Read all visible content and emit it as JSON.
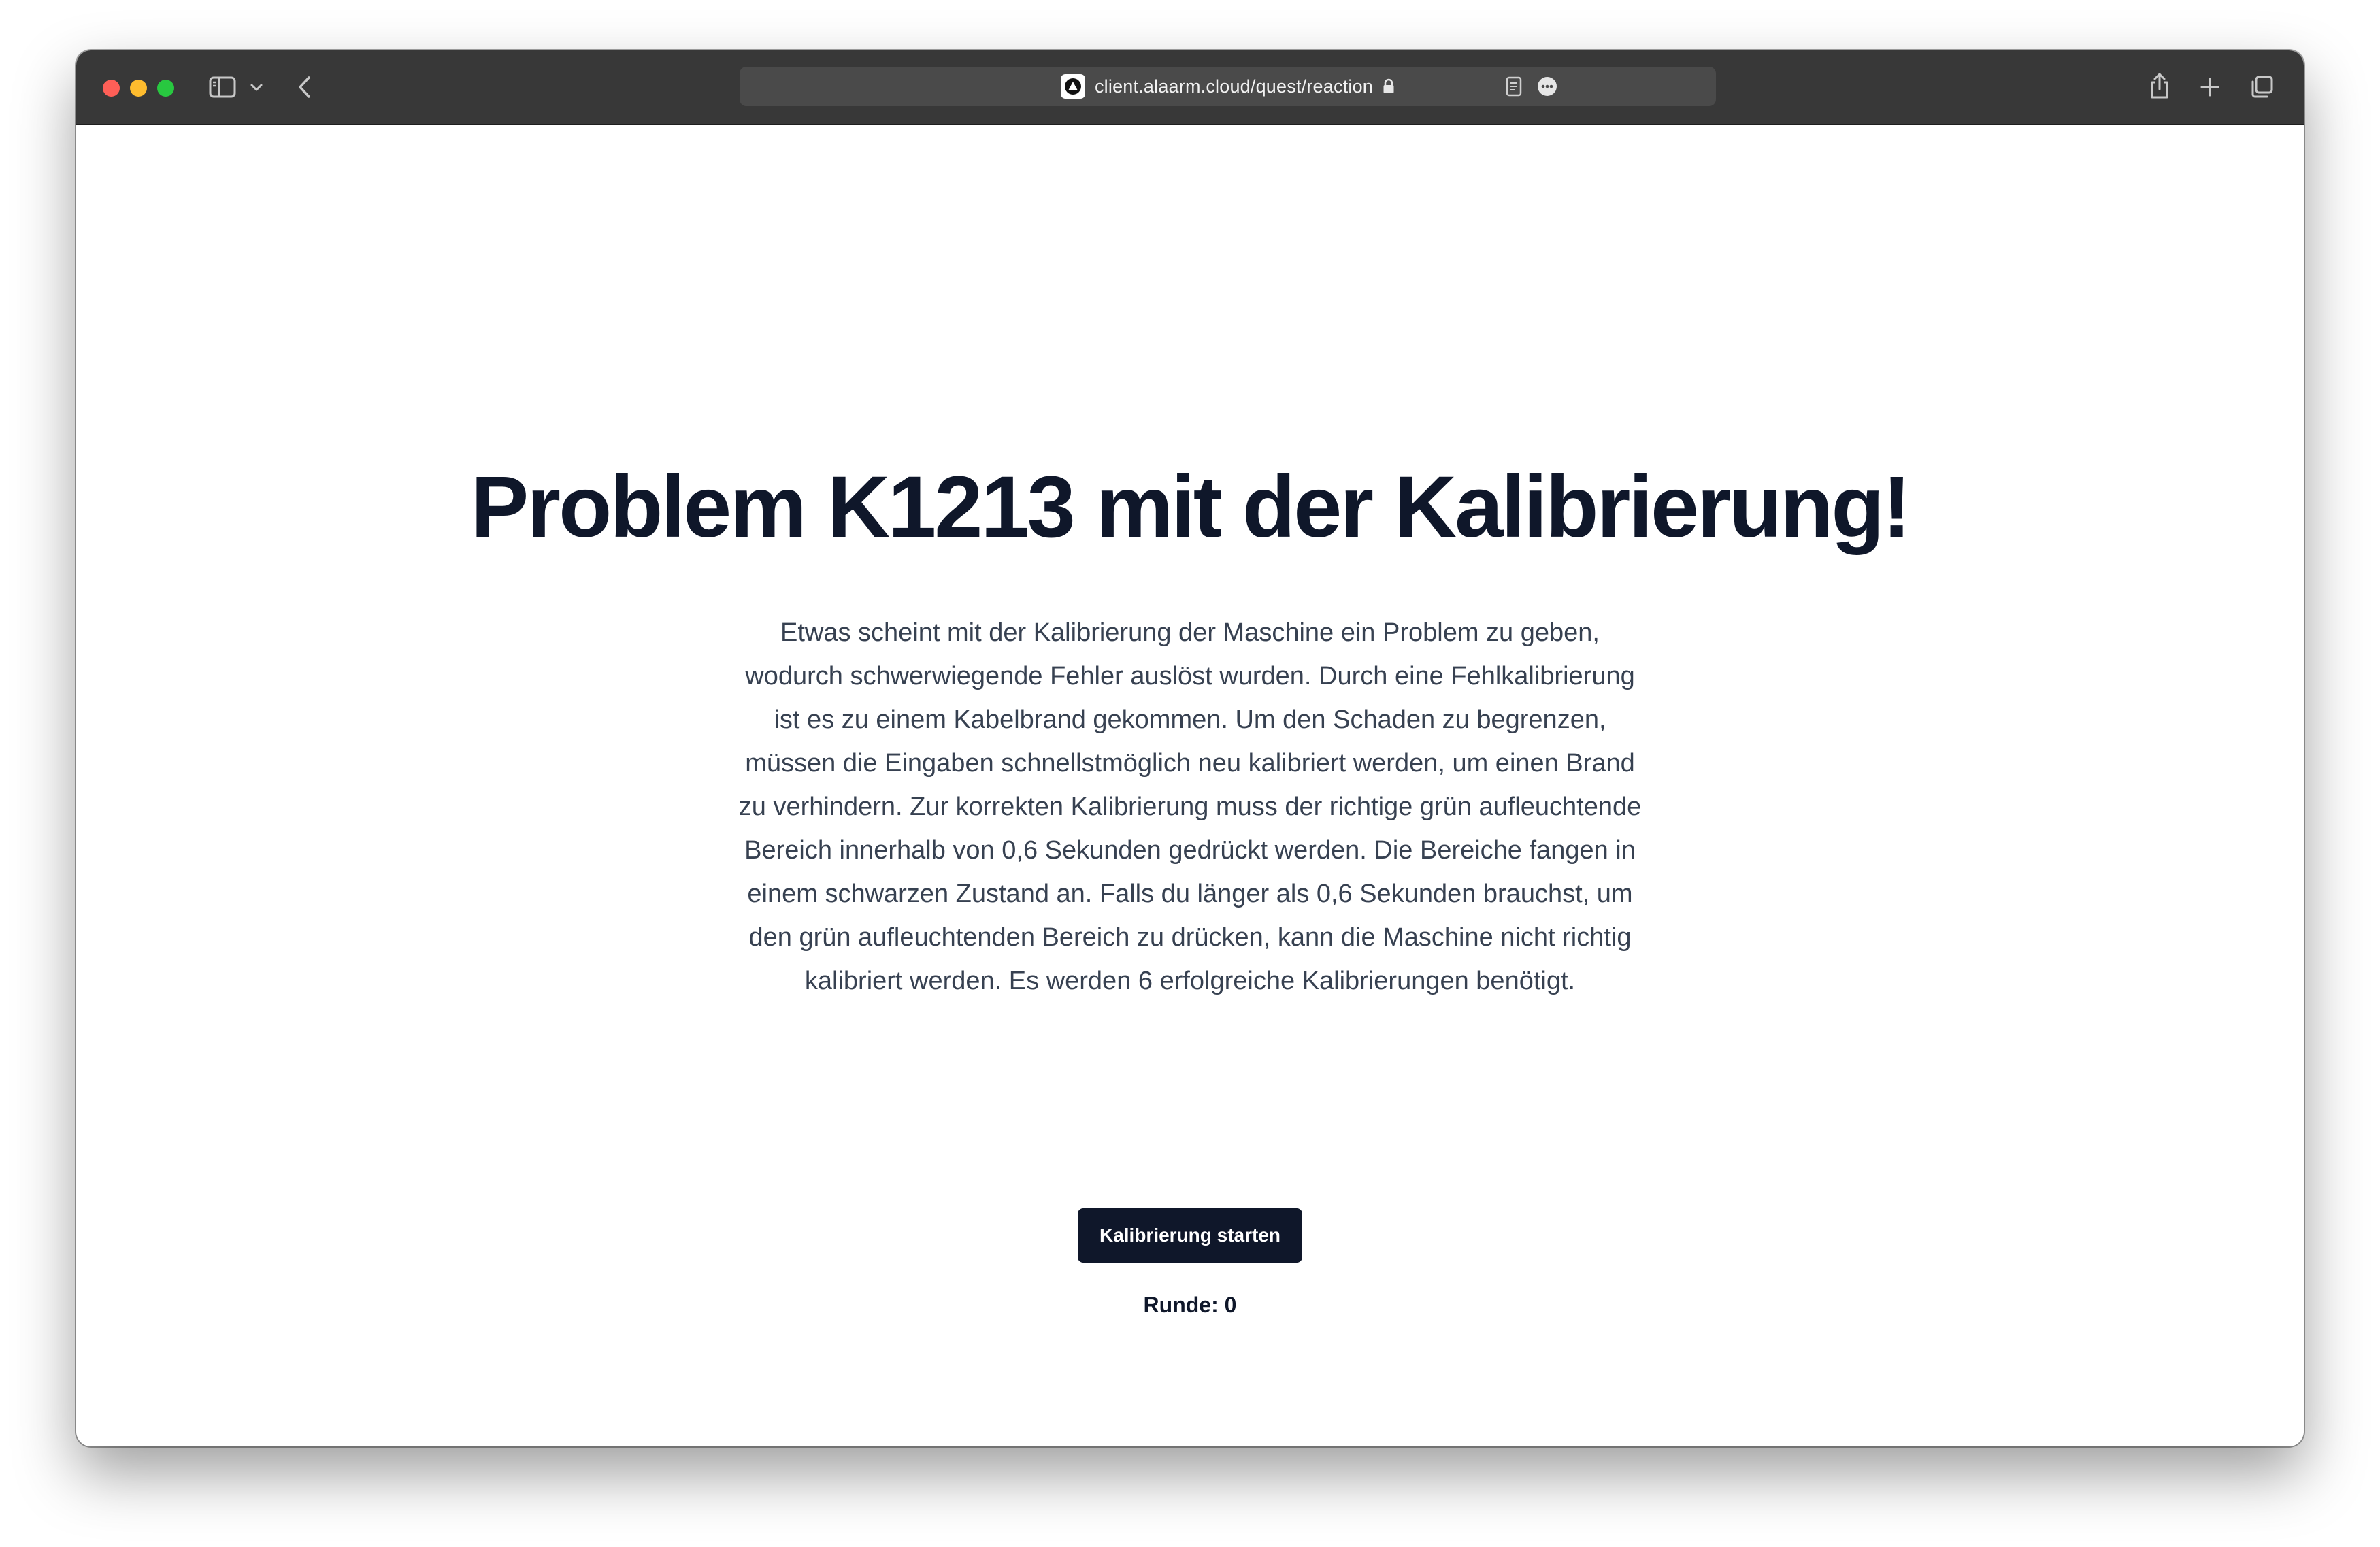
{
  "browser": {
    "url": "client.alaarm.cloud/quest/reaction",
    "icons": [
      "sidebar-icon",
      "chevron-down-icon",
      "back-icon",
      "favicon-icon",
      "lock-icon",
      "reader-icon",
      "more-icon",
      "share-icon",
      "plus-icon",
      "tabs-icon"
    ]
  },
  "page": {
    "title": "Problem K1213 mit der Kalibrierung!",
    "description": "Etwas scheint mit der Kalibrierung der Maschine ein Problem zu geben, wodurch schwerwiegende Fehler auslöst wurden. Durch eine Fehlkalibrierung ist es zu einem Kabelbrand gekommen. Um den Schaden zu begrenzen, müssen die Eingaben schnellstmöglich neu kalibriert werden, um einen Brand zu verhindern. Zur korrekten Kalibrierung muss der richtige grün aufleuchtende Bereich innerhalb von 0,6 Sekunden gedrückt werden. Die Bereiche fangen in einem schwarzen Zustand an. Falls du länger als 0,6 Sekunden brauchst, um den grün aufleuchtenden Bereich zu drücken, kann die Maschine nicht richtig kalibriert werden. Es werden 6 erfolgreiche Kalibrierungen benötigt.",
    "start_button": "Kalibrierung starten",
    "round_label": "Runde: 0"
  },
  "colors": {
    "titlebar": "#383838",
    "primary": "#0f172a",
    "body_text": "#374151"
  }
}
